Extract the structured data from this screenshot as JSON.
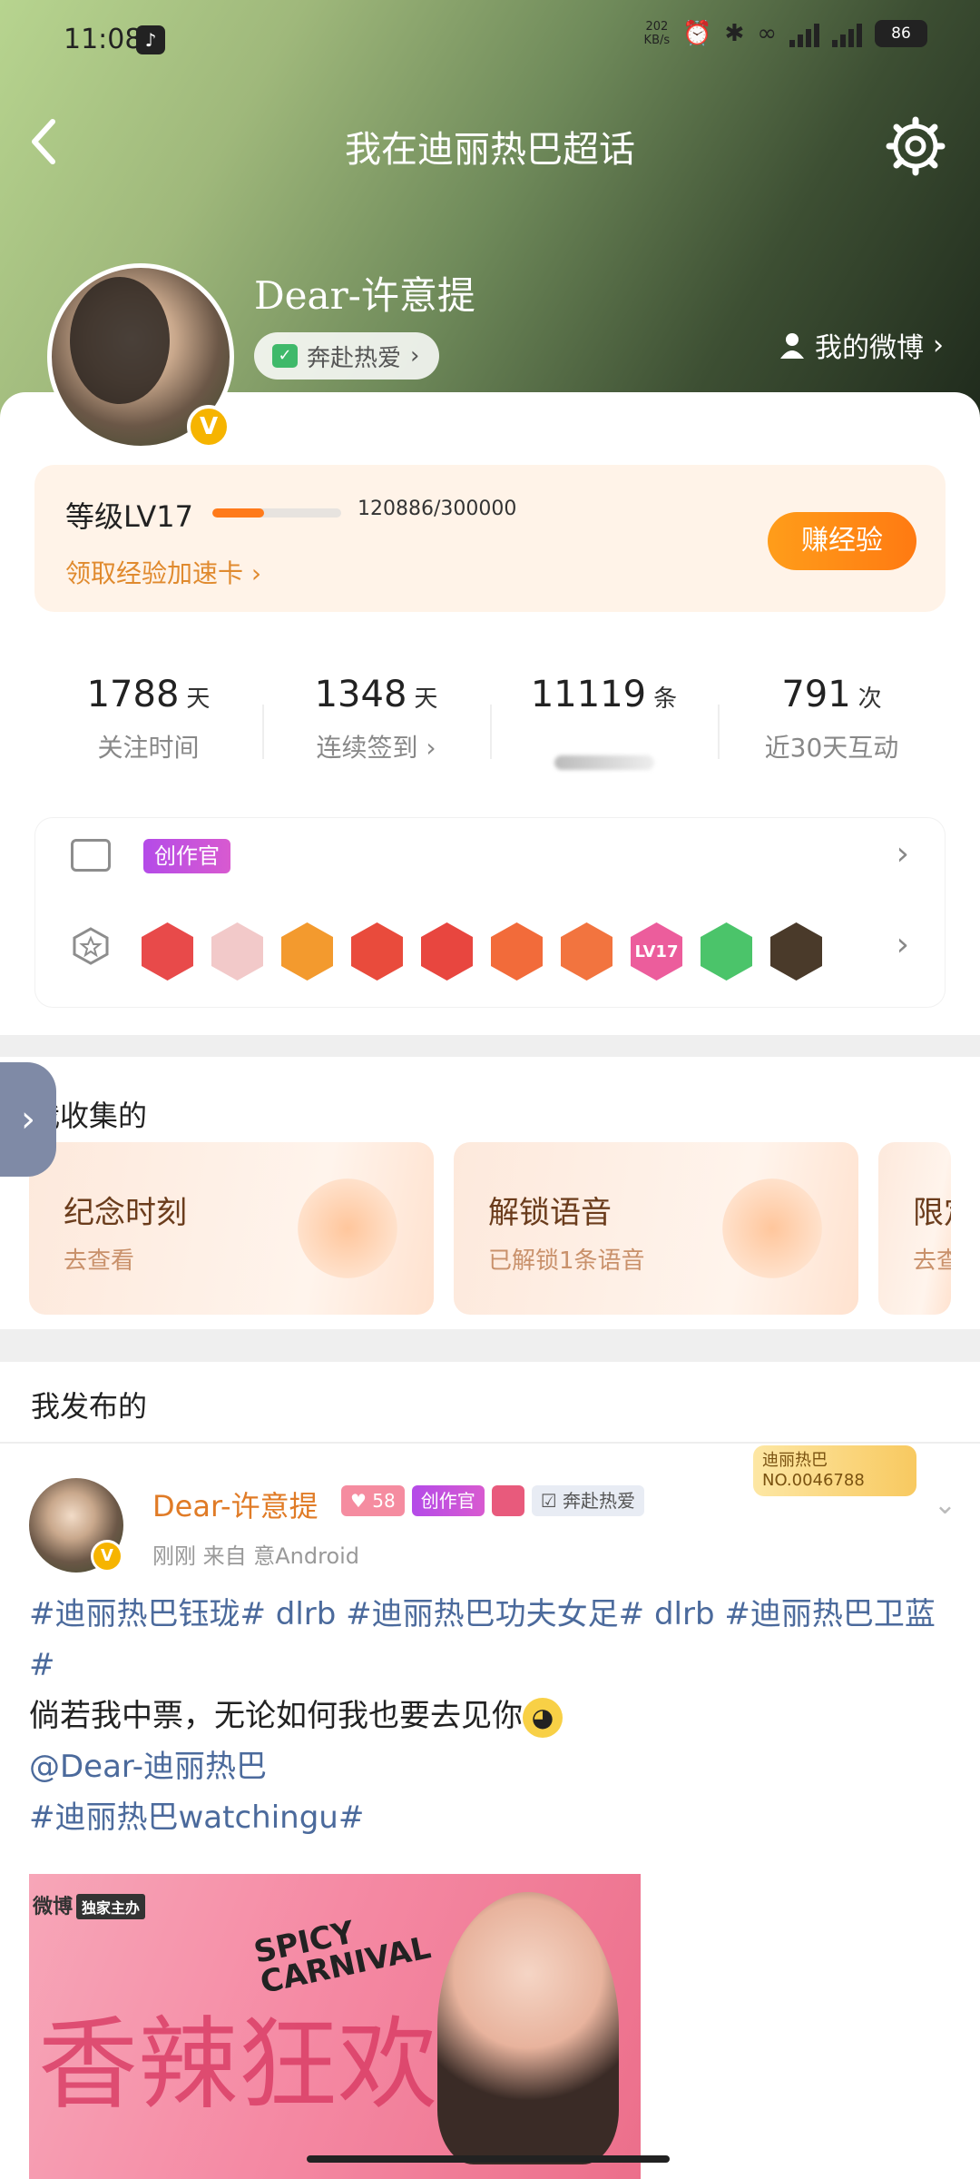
{
  "status_bar": {
    "time": "11:08",
    "net_speed": "202\nKB/s",
    "battery": "86"
  },
  "nav": {
    "title": "我在迪丽热巴超话"
  },
  "profile": {
    "username": "Dear-许意提",
    "tag": "奔赴热爱",
    "my_weibo": "我的微博",
    "vip": "V"
  },
  "level": {
    "label": "等级LV17",
    "exp": "120886/300000",
    "progress": 0.403,
    "card_link": "领取经验加速卡",
    "earn_button": "赚经验"
  },
  "stats": [
    {
      "value": "1788",
      "unit": "天",
      "label": "关注时间"
    },
    {
      "value": "1348",
      "unit": "天",
      "label": "连续签到"
    },
    {
      "value": "11119",
      "unit": "条",
      "label": ""
    },
    {
      "value": "791",
      "unit": "次",
      "label": "近30天互动"
    }
  ],
  "honors": {
    "creator_badge": "创作官",
    "medals": [
      {
        "color": "#e84a4a",
        "text": ""
      },
      {
        "color": "#f2c9c9",
        "text": ""
      },
      {
        "color": "#f39a2e",
        "text": ""
      },
      {
        "color": "#e94b3c",
        "text": ""
      },
      {
        "color": "#e8463f",
        "text": ""
      },
      {
        "color": "#f26b3a",
        "text": ""
      },
      {
        "color": "#f2743f",
        "text": ""
      },
      {
        "color": "#ec5d9c",
        "text": "LV17"
      },
      {
        "color": "#4bc46a",
        "text": ""
      },
      {
        "color": "#4a3a2a",
        "text": ""
      }
    ]
  },
  "collect": {
    "title": "我收集的",
    "cards": [
      {
        "title": "纪念时刻",
        "subtitle": "去查看"
      },
      {
        "title": "解锁语音",
        "subtitle": "已解锁1条语音"
      },
      {
        "title": "限定",
        "subtitle": "去查"
      }
    ]
  },
  "posts": {
    "title": "我发布的",
    "item": {
      "author": "Dear-许意提",
      "level_badge": "58",
      "creator_badge": "创作官",
      "tag_badge": "奔赴热爱",
      "fans_card_name": "迪丽热巴",
      "fans_card_no": "NO.0046788",
      "meta": "刚刚  来自 意Android",
      "line1": "#迪丽热巴钰珑# dlrb #迪丽热巴功夫女足# dlrb #迪丽热巴卫蓝#",
      "line2": "倘若我中票，无论如何我也要去见你",
      "mention": "@Dear-迪丽热巴",
      "line3": "#迪丽热巴watchingu#",
      "image": {
        "brand": "微博",
        "brand_tag": "独家主办",
        "title_en": "SPICY\nCARNIVAL",
        "title_zh": "香辣狂欢"
      }
    }
  }
}
